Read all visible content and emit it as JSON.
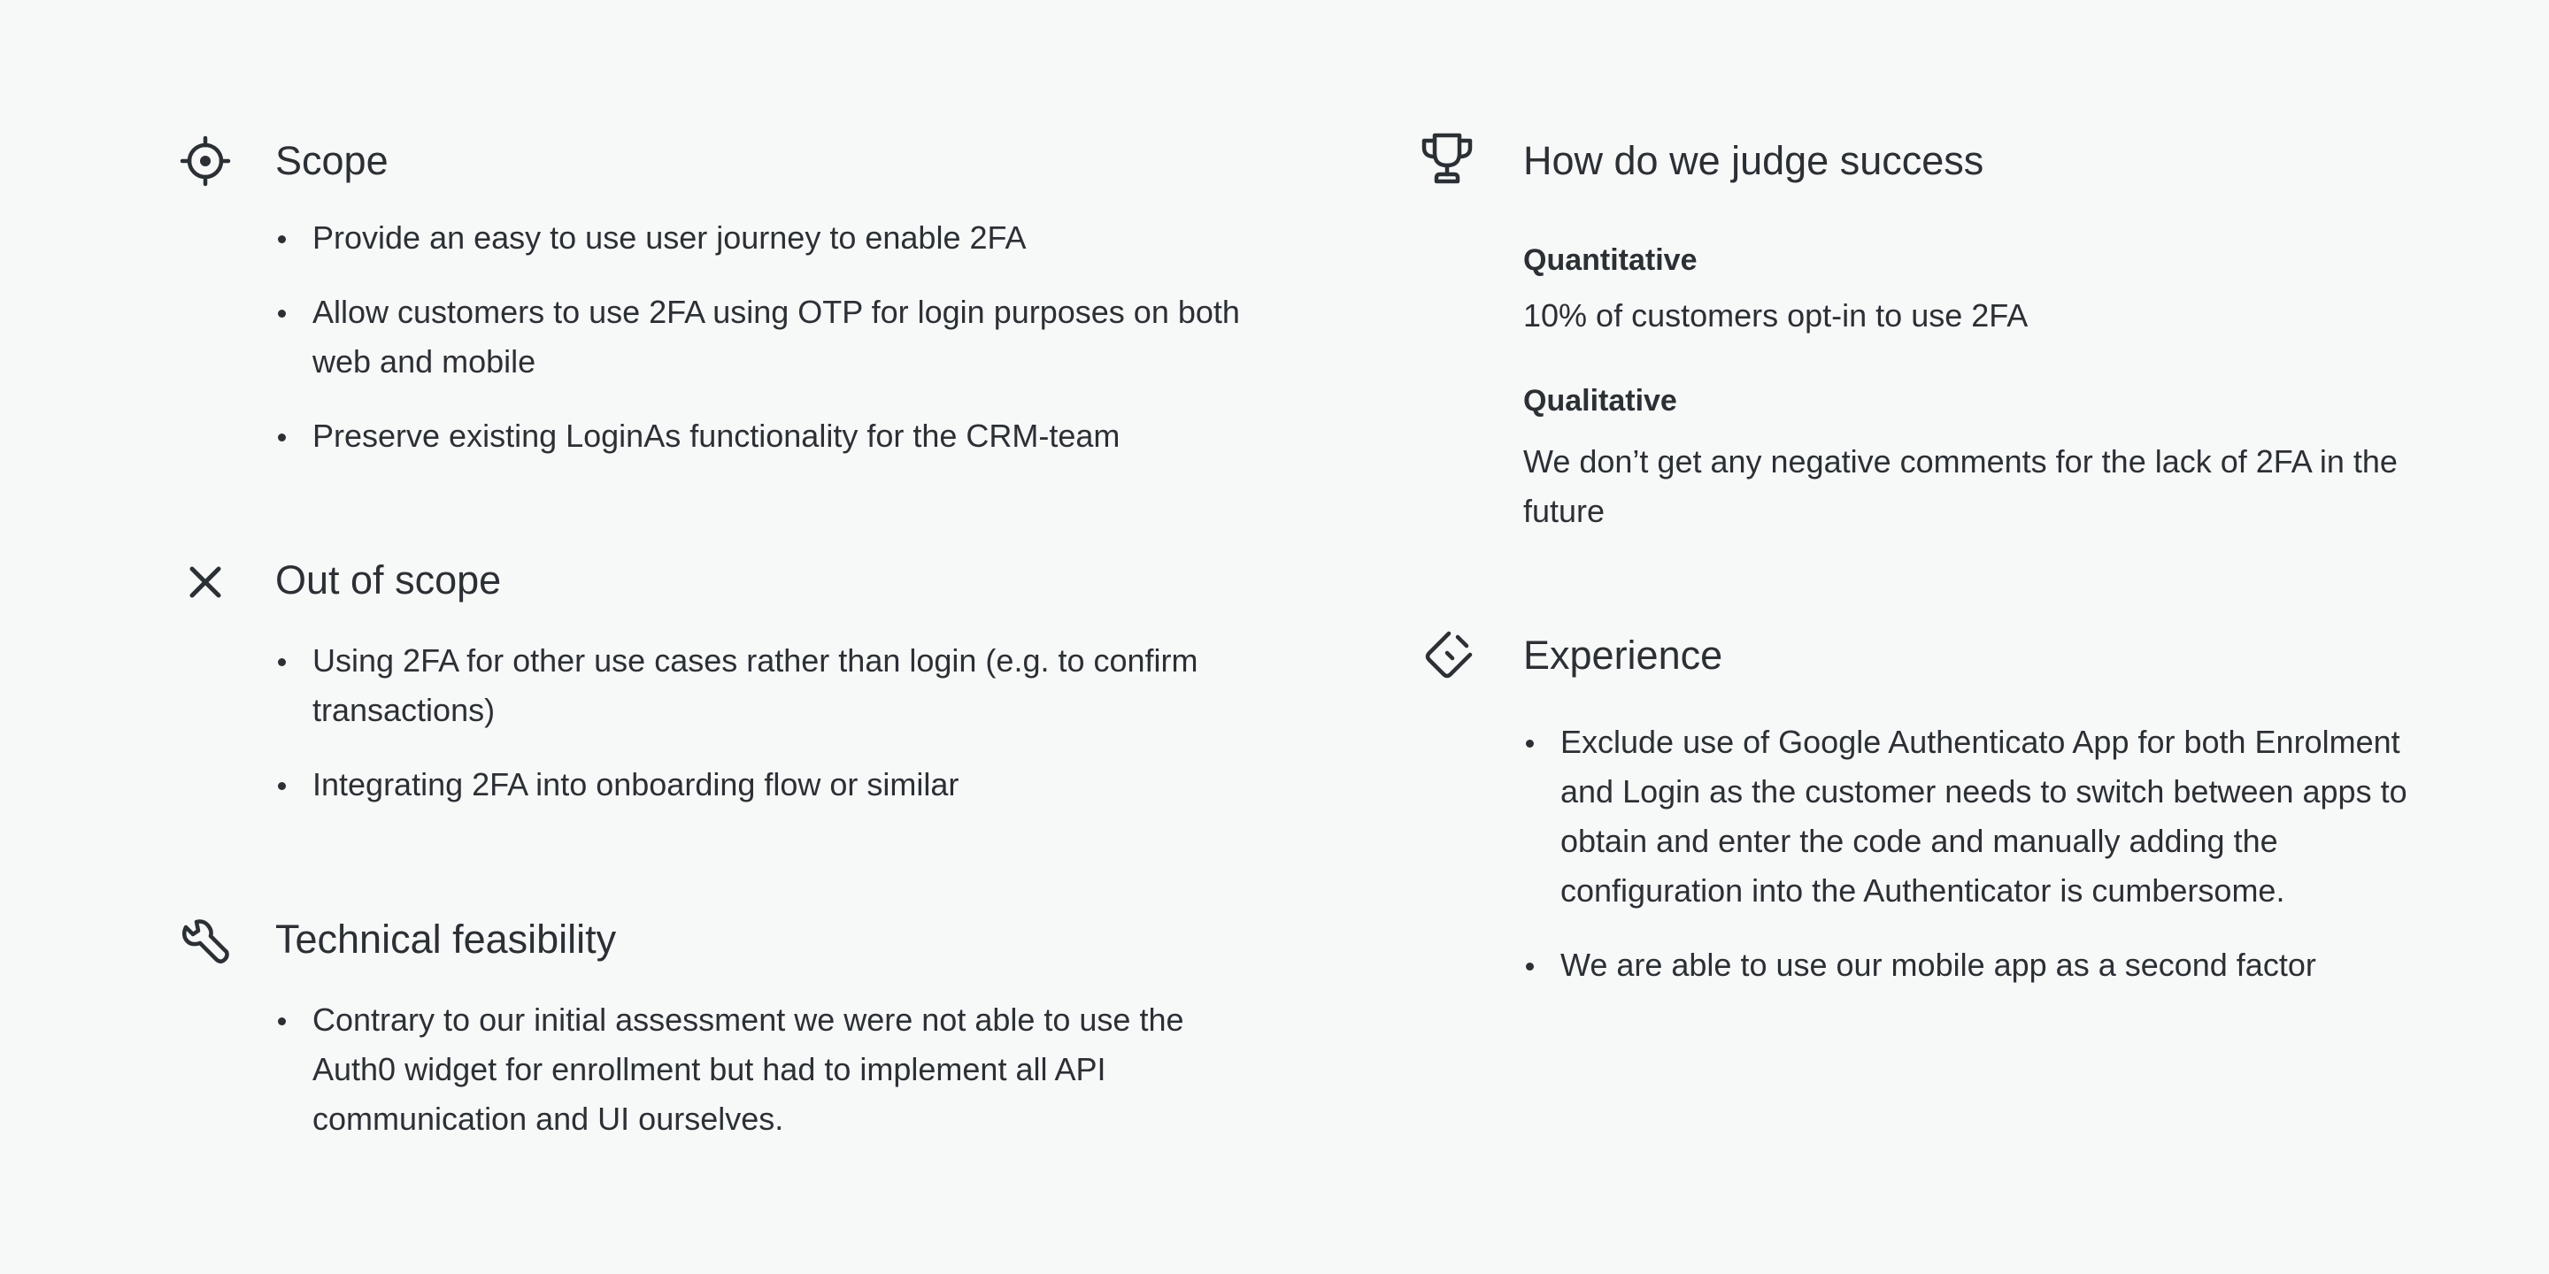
{
  "scope": {
    "icon": "target-icon",
    "title": "Scope",
    "items": [
      "Provide an easy to use user journey to enable 2FA",
      "Allow customers to use 2FA using OTP for login purposes on both web and mobile",
      "Preserve existing LoginAs functionality for the CRM-team"
    ]
  },
  "out_of_scope": {
    "icon": "close-icon",
    "title": "Out of scope",
    "items": [
      "Using 2FA for other use cases rather than login (e.g. to confirm transactions)",
      "Integrating 2FA into onboarding flow or similar"
    ]
  },
  "technical_feasibility": {
    "icon": "wrench-icon",
    "title": "Technical feasibility",
    "items": [
      "Contrary to our initial assessment we were not able to use the Auth0 widget for enrollment but had to implement all API communication and UI ourselves."
    ]
  },
  "success": {
    "icon": "trophy-icon",
    "title": "How do we judge success",
    "quantitative_label": "Quantitative",
    "quantitative_text": "10% of customers opt-in to use 2FA",
    "qualitative_label": "Qualitative",
    "qualitative_text": "We don’t get any negative comments for the lack of 2FA in the future"
  },
  "experience": {
    "icon": "experience-icon",
    "title": "Experience",
    "items": [
      "Exclude use of Google Authenticato App for both Enrolment and Login as the customer needs to switch between apps to obtain and enter the code and manually adding the configuration into the Authenticator is cumbersome.",
      "We are able to use our mobile app as a second factor"
    ]
  }
}
